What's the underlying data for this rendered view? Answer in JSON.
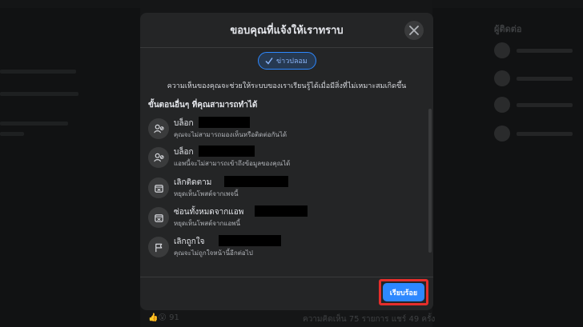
{
  "background": {
    "right_panel_title": "ผู้ติดต่อ",
    "post_reaction_count": "91",
    "post_stats": "ความคิดเห็น 75 รายการ แชร์ 49 ครั้ง"
  },
  "modal": {
    "title": "ขอบคุณที่แจ้งให้เราทราบ",
    "badge": {
      "label": "ข่าวปลอม",
      "icon": "check-icon"
    },
    "description": "ความเห็นของคุณจะช่วยให้ระบบของเราเรียนรู้ได้เมื่อมีสิ่งที่ไม่เหมาะสมเกิดขึ้น",
    "section_title": "ขั้นตอนอื่นๆ ที่คุณสามารถทำได้",
    "actions": [
      {
        "label": "บล็อก",
        "sub": "คุณจะไม่สามารถมองเห็นหรือติดต่อกันได้",
        "icon": "block-user-icon"
      },
      {
        "label": "บล็อก",
        "sub": "แอพนี้จะไม่สามารถเข้าถึงข้อมูลของคุณได้",
        "icon": "block-app-icon"
      },
      {
        "label": "เลิกติดตาม",
        "sub": "หยุดเห็นโพสต์จากเพจนี้",
        "icon": "unfollow-icon"
      },
      {
        "label": "ซ่อนทั้งหมดจากแอพ",
        "sub": "หยุดเห็นโพสต์จากแอพนี้",
        "icon": "hide-icon"
      },
      {
        "label": "เลิกถูกใจ",
        "sub": "คุณจะไม่ถูกใจหน้านี้อีกต่อไป",
        "icon": "flag-icon"
      }
    ],
    "done_label": "เรียบร้อย"
  },
  "colors": {
    "accent": "#2d88ff",
    "modal_bg": "#242526",
    "highlight": "#e52e2b"
  }
}
